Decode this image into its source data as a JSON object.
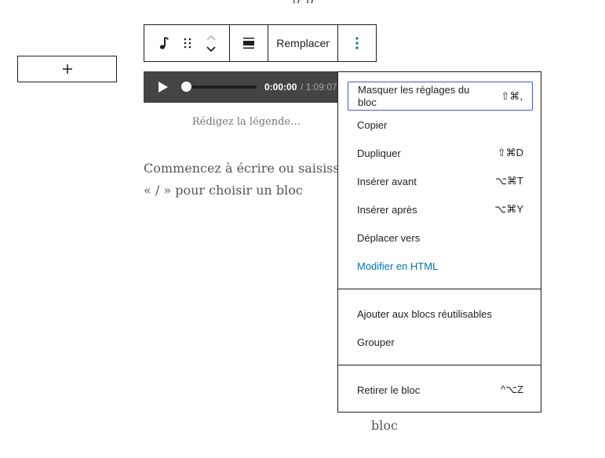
{
  "top_fragment": "p p",
  "inserter": {
    "icon": "plus-icon"
  },
  "toolbar": {
    "block_icon": "audio-icon",
    "drag_icon": "drag-handle-icon",
    "move_up_icon": "chevron-up-icon",
    "move_down_icon": "chevron-down-icon",
    "align_icon": "align-icon",
    "replace_label": "Remplacer",
    "more_icon": "more-vertical-icon"
  },
  "player": {
    "current_time": "0:00:00",
    "total_time": "/ 1:09:07",
    "progress": 0
  },
  "caption_placeholder": "Rédigez la légende…",
  "paragraph": {
    "line1": "Commencez à écrire ou saisissez",
    "line2": "« / » pour choisir un bloc"
  },
  "bottom_word": "bloc",
  "menu": {
    "group1": [
      {
        "label": "Masquer les réglages du bloc",
        "shortcut": "⇧⌘,"
      },
      {
        "label": "Copier",
        "shortcut": ""
      },
      {
        "label": "Dupliquer",
        "shortcut": "⇧⌘D"
      },
      {
        "label": "Insérer avant",
        "shortcut": "⌥⌘T"
      },
      {
        "label": "Insérer après",
        "shortcut": "⌥⌘Y"
      },
      {
        "label": "Déplacer vers",
        "shortcut": ""
      },
      {
        "label": "Modifier en HTML",
        "shortcut": ""
      }
    ],
    "group2": [
      {
        "label": "Ajouter aux blocs réutilisables"
      },
      {
        "label": "Grouper"
      }
    ],
    "group3": [
      {
        "label": "Retirer le bloc",
        "shortcut": "^⌥Z"
      }
    ]
  },
  "colors": {
    "accent": "#3858e9",
    "link": "#0073aa",
    "player_bg": "#444444"
  }
}
